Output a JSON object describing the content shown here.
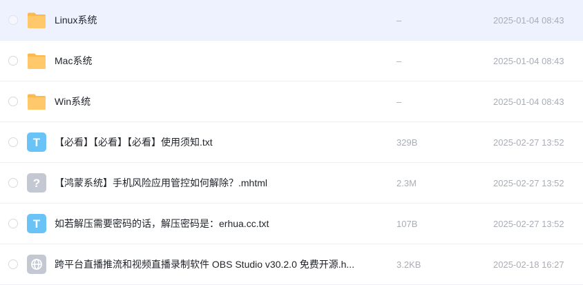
{
  "files": [
    {
      "name": "Linux系统",
      "size": "–",
      "date": "2025-01-04 08:43",
      "icon": "folder-icon",
      "selected": true
    },
    {
      "name": "Mac系统",
      "size": "–",
      "date": "2025-01-04 08:43",
      "icon": "folder-icon"
    },
    {
      "name": "Win系统",
      "size": "–",
      "date": "2025-01-04 08:43",
      "icon": "folder-icon"
    },
    {
      "name": "【必看】【必看】【必看】使用须知.txt",
      "size": "329B",
      "date": "2025-02-27 13:52",
      "icon": "text-file-icon",
      "icon_glyph": "T"
    },
    {
      "name": "【鸿蒙系统】手机风险应用管控如何解除？.mhtml",
      "size": "2.3M",
      "date": "2025-02-27 13:52",
      "icon": "unknown-file-icon",
      "icon_glyph": "?"
    },
    {
      "name": "如若解压需要密码的话，解压密码是：erhua.cc.txt",
      "size": "107B",
      "date": "2025-02-27 13:52",
      "icon": "text-file-icon",
      "icon_glyph": "T"
    },
    {
      "name": "跨平台直播推流和视频直播录制软件 OBS Studio v30.2.0 免费开源.h...",
      "size": "3.2KB",
      "date": "2025-02-18 16:27",
      "icon": "web-file-icon"
    }
  ],
  "colors": {
    "selected_row": "#eef2ff",
    "folder": "#ffc65e",
    "text_icon": "#6ac3f7",
    "unknown_icon": "#c3c8d3",
    "web_icon": "#c3c8d3",
    "meta_text": "#a8adb6"
  }
}
